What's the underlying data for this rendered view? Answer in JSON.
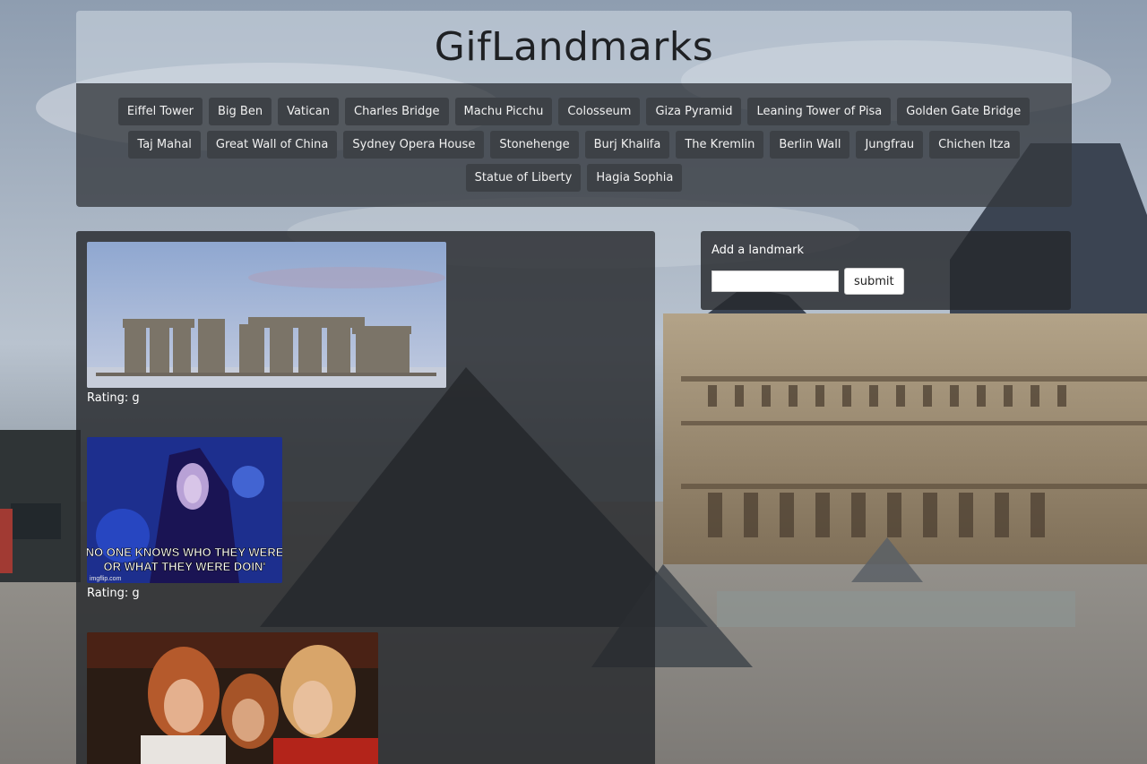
{
  "header": {
    "title": "GifLandmarks"
  },
  "nav": {
    "buttons": [
      "Eiffel Tower",
      "Big Ben",
      "Vatican",
      "Charles Bridge",
      "Machu Picchu",
      "Colosseum",
      "Giza Pyramid",
      "Leaning Tower of Pisa",
      "Golden Gate Bridge",
      "Taj Mahal",
      "Great Wall of China",
      "Sydney Opera House",
      "Stonehenge",
      "Burj Khalifa",
      "The Kremlin",
      "Berlin Wall",
      "Jungfrau",
      "Chichen Itza",
      "Statue of Liberty",
      "Hagia Sophia"
    ]
  },
  "gifs": [
    {
      "rating": "Rating: g",
      "subject": "stonehenge"
    },
    {
      "rating": "Rating: g",
      "subject": "meme",
      "caption_line1": "NO ONE KNOWS WHO THEY WERE",
      "caption_line2": "OR WHAT THEY WERE DOIN'",
      "watermark": "imgflip.com"
    },
    {
      "rating": "",
      "subject": "band"
    }
  ],
  "add_landmark": {
    "label": "Add a landmark",
    "input_value": "",
    "submit_label": "submit"
  },
  "colors": {
    "nav_button_bg": "#3d4146",
    "panel_bg": "#26282c",
    "header_top_bg": "#d2dae4"
  }
}
